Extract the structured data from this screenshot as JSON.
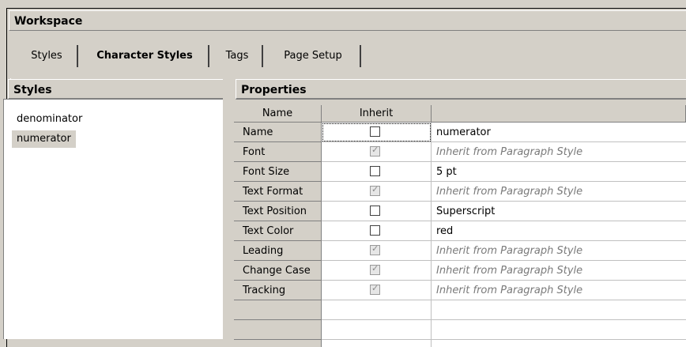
{
  "workspace": {
    "title": "Workspace"
  },
  "tabs": [
    {
      "label": "Styles",
      "active": false
    },
    {
      "label": "Character Styles",
      "active": true
    },
    {
      "label": "Tags",
      "active": false
    },
    {
      "label": "Page Setup",
      "active": false
    }
  ],
  "styles_pane": {
    "title": "Styles",
    "items": [
      {
        "label": "denominator",
        "selected": false
      },
      {
        "label": "numerator",
        "selected": true
      }
    ]
  },
  "properties_pane": {
    "title": "Properties",
    "columns": {
      "name": "Name",
      "inherit": "Inherit",
      "value": ""
    },
    "rows": [
      {
        "name": "Name",
        "inherit": false,
        "value": "numerator",
        "inherited_display": false
      },
      {
        "name": "Font",
        "inherit": true,
        "value": "Inherit from Paragraph Style",
        "inherited_display": true
      },
      {
        "name": "Font Size",
        "inherit": false,
        "value": "5 pt",
        "inherited_display": false
      },
      {
        "name": "Text Format",
        "inherit": true,
        "value": "Inherit from Paragraph Style",
        "inherited_display": true
      },
      {
        "name": "Text Position",
        "inherit": false,
        "value": "Superscript",
        "inherited_display": false
      },
      {
        "name": "Text Color",
        "inherit": false,
        "value": "red",
        "inherited_display": false
      },
      {
        "name": "Leading",
        "inherit": true,
        "value": "Inherit from Paragraph Style",
        "inherited_display": true
      },
      {
        "name": "Change Case",
        "inherit": true,
        "value": "Inherit from Paragraph Style",
        "inherited_display": true
      },
      {
        "name": "Tracking",
        "inherit": true,
        "value": "Inherit from Paragraph Style",
        "inherited_display": true
      }
    ]
  }
}
